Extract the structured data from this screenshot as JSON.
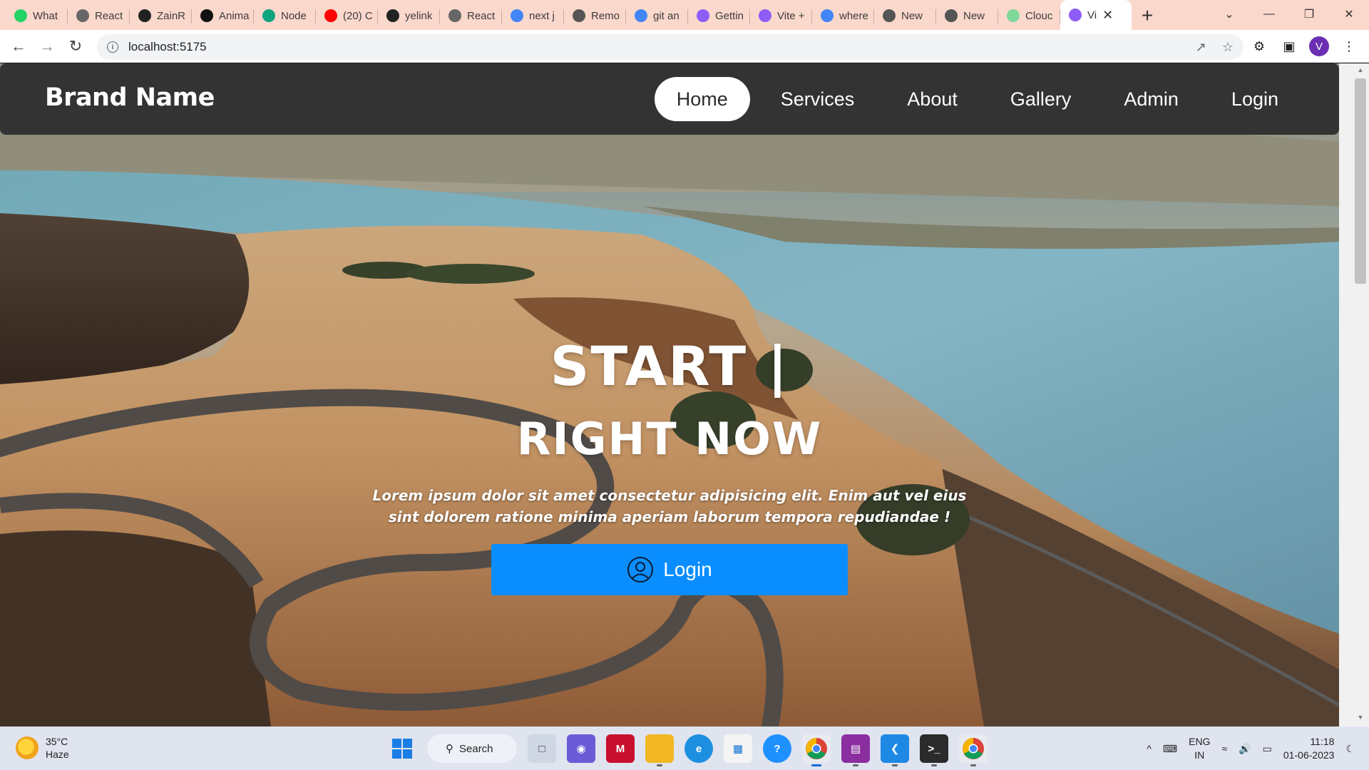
{
  "browser": {
    "tabs": [
      {
        "title": "What",
        "icon": "whatsapp-icon",
        "color": "#25d366"
      },
      {
        "title": "React",
        "icon": "globe-icon",
        "color": "#666666"
      },
      {
        "title": "ZainR",
        "icon": "github-icon",
        "color": "#222222"
      },
      {
        "title": "Anima",
        "icon": "framer-icon",
        "color": "#111111"
      },
      {
        "title": "Node",
        "icon": "openai-icon",
        "color": "#10a37f"
      },
      {
        "title": "(20) C",
        "icon": "youtube-icon",
        "color": "#ff0000"
      },
      {
        "title": "yelink",
        "icon": "github-icon",
        "color": "#222222"
      },
      {
        "title": "React",
        "icon": "globe-icon",
        "color": "#666666"
      },
      {
        "title": "next j",
        "icon": "google-icon",
        "color": "#4285f4"
      },
      {
        "title": "Remo",
        "icon": "remote-icon",
        "color": "#555555"
      },
      {
        "title": "git an",
        "icon": "google-icon",
        "color": "#4285f4"
      },
      {
        "title": "Gettin",
        "icon": "vite-icon",
        "color": "#8e5cf7"
      },
      {
        "title": "Vite +",
        "icon": "vite-icon",
        "color": "#8e5cf7"
      },
      {
        "title": "where",
        "icon": "google-icon",
        "color": "#4285f4"
      },
      {
        "title": "New",
        "icon": "chrome-icon",
        "color": "#555555"
      },
      {
        "title": "New",
        "icon": "chrome-icon",
        "color": "#555555"
      },
      {
        "title": "Clouc",
        "icon": "cloud-icon",
        "color": "#7fd89a"
      }
    ],
    "active_tab": {
      "title": "Vi",
      "icon": "vite-icon",
      "color": "#8e5cf7"
    },
    "url": "localhost:5175",
    "profile_initial": "V"
  },
  "site": {
    "brand": "Brand Name",
    "nav": [
      {
        "label": "Home",
        "active": true
      },
      {
        "label": "Services",
        "active": false
      },
      {
        "label": "About",
        "active": false
      },
      {
        "label": "Gallery",
        "active": false
      },
      {
        "label": "Admin",
        "active": false
      },
      {
        "label": "Login",
        "active": false
      }
    ],
    "hero": {
      "line1": "START |",
      "line2": "RIGHT NOW",
      "description": "Lorem ipsum dolor sit amet consectetur adipisicing elit. Enim aut vel eius sint dolorem ratione minima aperiam laborum tempora repudiandae !",
      "cta_label": "Login"
    },
    "colors": {
      "navbar": "#333333",
      "cta": "#0a8eff"
    }
  },
  "taskbar": {
    "weather": {
      "temp": "35°C",
      "condition": "Haze"
    },
    "search_label": "Search",
    "tray": {
      "lang_top": "ENG",
      "lang_bottom": "IN",
      "time": "11:18",
      "date": "01-06-2023"
    }
  }
}
